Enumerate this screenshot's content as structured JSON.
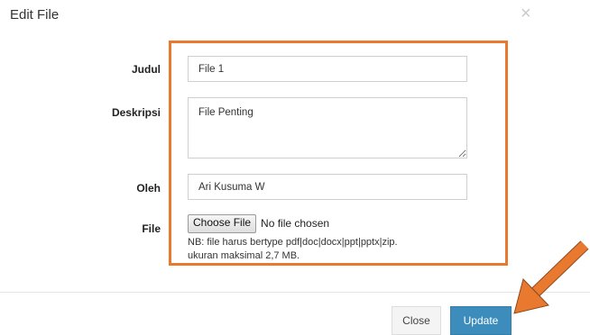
{
  "modal": {
    "title": "Edit File",
    "close_symbol": "×"
  },
  "form": {
    "judul": {
      "label": "Judul",
      "value": "File 1"
    },
    "deskripsi": {
      "label": "Deskripsi",
      "value": "File Penting"
    },
    "oleh": {
      "label": "Oleh",
      "value": "Ari Kusuma W"
    },
    "file": {
      "label": "File",
      "button_label": "Choose File",
      "status": "No file chosen",
      "note_line1": "NB: file harus bertype pdf|doc|docx|ppt|pptx|zip.",
      "note_line2": "ukuran maksimal 2,7 MB."
    }
  },
  "footer": {
    "close_label": "Close",
    "update_label": "Update"
  },
  "annotations": {
    "highlight_color": "#e8792e",
    "arrow_color": "#e8792e",
    "arrow_icon": "arrow-pointing-to-update-icon"
  },
  "colors": {
    "primary_button": "#3c8dbc",
    "default_button": "#f4f4f4"
  }
}
